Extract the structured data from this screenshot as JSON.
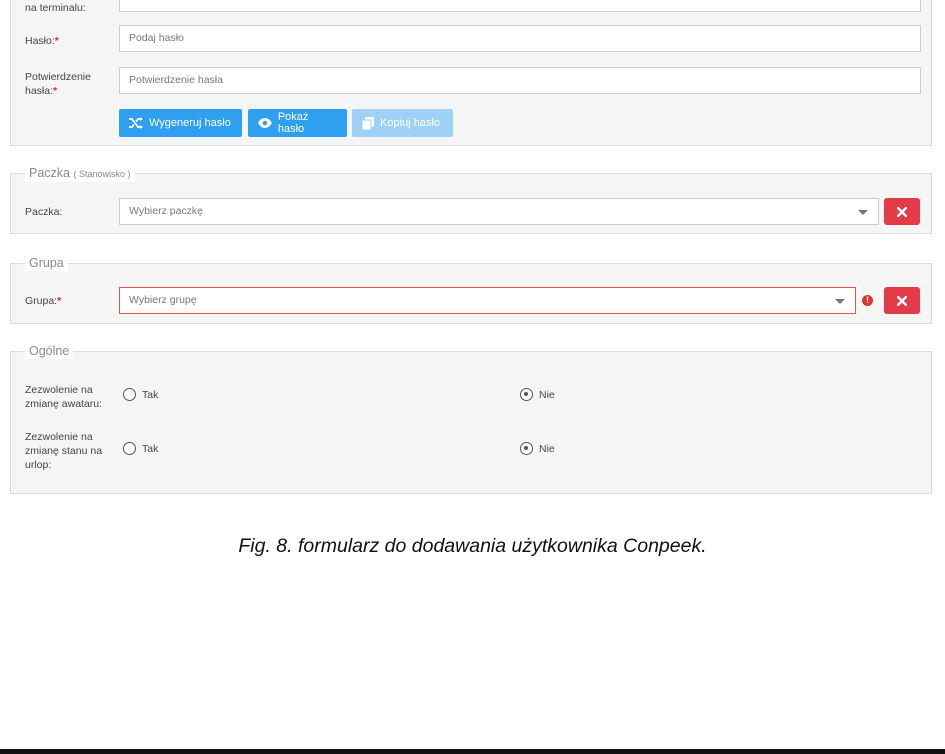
{
  "credentials": {
    "terminal_label": "na terminalu:",
    "terminal_value": "",
    "password_label": "Hasło:",
    "password_placeholder": "Podaj hasło",
    "confirm_label_line1": "Potwierdzenie",
    "confirm_label_line2": "hasła:",
    "confirm_placeholder": "Potwierdzenie hasła",
    "required_mark": "*",
    "generate_button": "Wygeneruj hasło",
    "show_button": "Pokaż hasło",
    "copy_button": "Kopiuj hasło"
  },
  "package_section": {
    "legend": "Paczka",
    "legend_sub": "( Stanowisko )",
    "label": "Paczka:",
    "placeholder": "Wybierz paczkę"
  },
  "group_section": {
    "legend": "Grupa",
    "label": "Grupa:",
    "placeholder": "Wybierz grupę",
    "error_mark": "!"
  },
  "general_section": {
    "legend": "Ogólne",
    "avatar_label_lines": [
      "Zezwolenie na",
      "zmianę awataru:"
    ],
    "leave_label_lines": [
      "Zezwolenie na",
      "zmianę stanu na",
      "urlop:"
    ],
    "yes": "Tak",
    "no": "Nie",
    "avatar_selected": "Nie",
    "leave_selected": "Nie"
  },
  "caption": "Fig. 8. formularz do dodawania użytkownika Conpeek."
}
